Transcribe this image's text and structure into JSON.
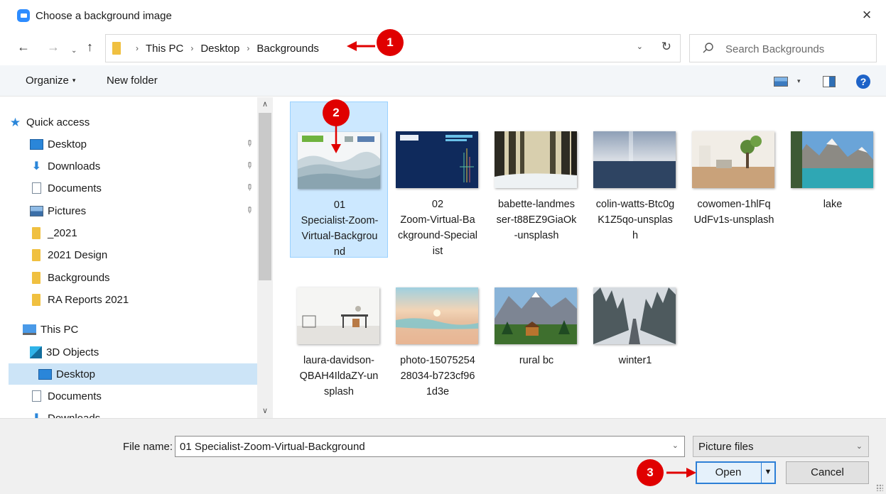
{
  "window": {
    "title": "Choose a background image",
    "close_icon": "×"
  },
  "nav": {
    "back": "←",
    "forward": "→",
    "recent": "⌄",
    "up": "↑"
  },
  "address": {
    "crumbs": [
      "This PC",
      "Desktop",
      "Backgrounds"
    ],
    "separator": "›",
    "dropdown": "⌄",
    "refresh": "↻"
  },
  "search": {
    "placeholder": "Search Backgrounds"
  },
  "toolbar": {
    "organize": "Organize",
    "organize_caret": "▾",
    "new_folder": "New folder",
    "view_caret": "▾",
    "help": "?"
  },
  "sidebar": {
    "items": [
      {
        "label": "Quick access",
        "icon": "star-icon",
        "pinned": false
      },
      {
        "label": "Desktop",
        "icon": "desktop-icon",
        "pinned": true
      },
      {
        "label": "Downloads",
        "icon": "downloads-icon",
        "pinned": true
      },
      {
        "label": "Documents",
        "icon": "documents-icon",
        "pinned": true
      },
      {
        "label": "Pictures",
        "icon": "pictures-icon",
        "pinned": true
      },
      {
        "label": "_2021",
        "icon": "folder-icon",
        "pinned": false
      },
      {
        "label": "2021 Design",
        "icon": "folder-icon",
        "pinned": false
      },
      {
        "label": "Backgrounds",
        "icon": "folder-icon",
        "pinned": false
      },
      {
        "label": "RA Reports 2021",
        "icon": "folder-icon",
        "pinned": false
      },
      {
        "label": "This PC",
        "icon": "this-pc-icon",
        "pinned": false
      },
      {
        "label": "3D Objects",
        "icon": "3d-objects-icon",
        "pinned": false
      },
      {
        "label": "Desktop",
        "icon": "desktop-icon",
        "pinned": false,
        "selected": true
      },
      {
        "label": "Documents",
        "icon": "documents-icon",
        "pinned": false
      },
      {
        "label": "Downloads",
        "icon": "downloads-icon",
        "pinned": false
      }
    ],
    "pin_glyph": "📌",
    "scroll_up": "∧",
    "scroll_down": "∨"
  },
  "files": [
    {
      "lines": [
        "01",
        "Specialist-Zoom-",
        "Virtual-Backgrou",
        "nd"
      ],
      "selected": true,
      "thumb": "specialist-zoom-1"
    },
    {
      "lines": [
        "02",
        "Zoom-Virtual-Ba",
        "ckground-Special",
        "ist"
      ],
      "selected": false,
      "thumb": "specialist-zoom-2"
    },
    {
      "lines": [
        "babette-landmes",
        "ser-t88EZ9GiaOk",
        "-unsplash"
      ],
      "selected": false,
      "thumb": "forest"
    },
    {
      "lines": [
        "colin-watts-Btc0g",
        "K1Z5qo-unsplas",
        "h"
      ],
      "selected": false,
      "thumb": "sea"
    },
    {
      "lines": [
        "cowomen-1hlFq",
        "UdFv1s-unsplash"
      ],
      "selected": false,
      "thumb": "room"
    },
    {
      "lines": [
        "lake"
      ],
      "selected": false,
      "thumb": "lake"
    },
    {
      "lines": [
        "laura-davidson-",
        "QBAH4IldaZY-un",
        "splash"
      ],
      "selected": false,
      "thumb": "office"
    },
    {
      "lines": [
        "photo-15075254",
        "28034-b723cf96",
        "1d3e"
      ],
      "selected": false,
      "thumb": "beach"
    },
    {
      "lines": [
        "rural bc"
      ],
      "selected": false,
      "thumb": "rural"
    },
    {
      "lines": [
        "winter1"
      ],
      "selected": false,
      "thumb": "winter"
    }
  ],
  "footer": {
    "file_name_label": "File name:",
    "file_name_value": "01 Specialist-Zoom-Virtual-Background",
    "dropdown": "⌄",
    "file_type": "Picture files",
    "open": "Open",
    "open_arrow": "▼",
    "cancel": "Cancel"
  },
  "annotations": [
    {
      "number": "1"
    },
    {
      "number": "2"
    },
    {
      "number": "3"
    }
  ],
  "colors": {
    "callout": "#e00000",
    "selection": "#cce8ff",
    "accent": "#2d7fd6"
  }
}
